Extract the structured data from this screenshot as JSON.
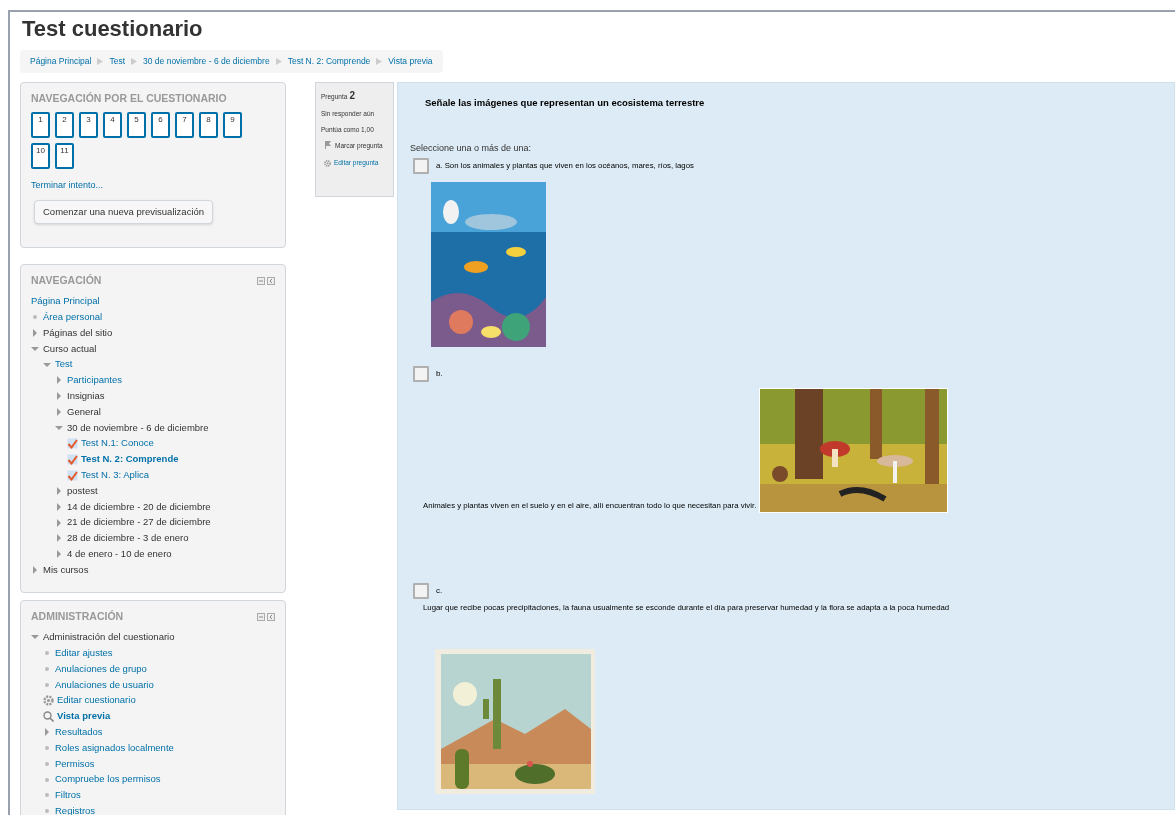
{
  "page_title": "Test cuestionario",
  "breadcrumb": [
    "Página Principal",
    "Test",
    "30 de noviembre - 6 de diciembre",
    "Test N. 2: Comprende",
    "Vista previa"
  ],
  "quiz_navigation": {
    "title": "NAVEGACIÓN POR EL CUESTIONARIO",
    "questions": [
      "1",
      "2",
      "3",
      "4",
      "5",
      "6",
      "7",
      "8",
      "9",
      "10",
      "11"
    ],
    "finish_link": "Terminar intento...",
    "button": "Comenzar una nueva previsualización"
  },
  "navigation": {
    "title": "NAVEGACIÓN",
    "items": [
      {
        "label": "Página Principal",
        "kind": "page",
        "link": true,
        "current": false
      },
      {
        "label": "Área personal",
        "kind": "bullet",
        "link": true,
        "current": false
      },
      {
        "label": "Páginas del sitio",
        "kind": "branch",
        "expanded": false,
        "link": false,
        "current": false
      },
      {
        "label": "Curso actual",
        "kind": "branch",
        "expanded": true,
        "link": false,
        "current": false,
        "children": [
          {
            "label": "Test",
            "kind": "branch",
            "expanded": true,
            "link": true,
            "current": false,
            "children": [
              {
                "label": "Participantes",
                "kind": "branch",
                "expanded": false,
                "link": true,
                "current": false
              },
              {
                "label": "Insignias",
                "kind": "branch",
                "expanded": false,
                "link": false,
                "current": false
              },
              {
                "label": "General",
                "kind": "branch",
                "expanded": false,
                "link": false,
                "current": false
              },
              {
                "label": "30 de noviembre - 6 de diciembre",
                "kind": "branch",
                "expanded": true,
                "link": false,
                "current": false,
                "children": [
                  {
                    "label": "Test N.1: Conoce",
                    "kind": "check",
                    "link": true,
                    "current": false
                  },
                  {
                    "label": "Test N. 2: Comprende",
                    "kind": "check",
                    "link": true,
                    "current": true
                  },
                  {
                    "label": "Test N. 3: Aplica",
                    "kind": "check",
                    "link": true,
                    "current": false
                  }
                ]
              },
              {
                "label": "postest",
                "kind": "branch",
                "expanded": false,
                "link": false,
                "current": false
              },
              {
                "label": "14 de diciembre - 20 de diciembre",
                "kind": "branch",
                "expanded": false,
                "link": false,
                "current": false
              },
              {
                "label": "21 de diciembre - 27 de diciembre",
                "kind": "branch",
                "expanded": false,
                "link": false,
                "current": false
              },
              {
                "label": "28 de diciembre - 3 de enero",
                "kind": "branch",
                "expanded": false,
                "link": false,
                "current": false
              },
              {
                "label": "4 de enero - 10 de enero",
                "kind": "branch",
                "expanded": false,
                "link": false,
                "current": false
              }
            ]
          }
        ]
      },
      {
        "label": "Mis cursos",
        "kind": "branch",
        "expanded": false,
        "link": false,
        "current": false
      }
    ]
  },
  "administration": {
    "title": "ADMINISTRACIÓN",
    "items": [
      {
        "label": "Administración del cuestionario",
        "kind": "branch",
        "expanded": true,
        "link": false,
        "current": false,
        "children": [
          {
            "label": "Editar ajustes",
            "kind": "bullet",
            "link": true,
            "current": false
          },
          {
            "label": "Anulaciones de grupo",
            "kind": "bullet",
            "link": true,
            "current": false
          },
          {
            "label": "Anulaciones de usuario",
            "kind": "bullet",
            "link": true,
            "current": false
          },
          {
            "label": "Editar cuestionario",
            "kind": "gear",
            "link": true,
            "current": false
          },
          {
            "label": "Vista previa",
            "kind": "search",
            "link": true,
            "current": true
          },
          {
            "label": "Resultados",
            "kind": "branch",
            "expanded": false,
            "link": true,
            "current": false
          },
          {
            "label": "Roles asignados localmente",
            "kind": "bullet",
            "link": true,
            "current": false
          },
          {
            "label": "Permisos",
            "kind": "bullet",
            "link": true,
            "current": false
          },
          {
            "label": "Compruebe los permisos",
            "kind": "bullet",
            "link": true,
            "current": false
          },
          {
            "label": "Filtros",
            "kind": "bullet",
            "link": true,
            "current": false
          },
          {
            "label": "Registros",
            "kind": "bullet",
            "link": true,
            "current": false
          }
        ]
      }
    ]
  },
  "question_info": {
    "label": "Pregunta",
    "number": "2",
    "status": "Sin responder aún",
    "grade": "Puntúa como 1,00",
    "flag": "Marcar pregunta",
    "edit": "Editar pregunta"
  },
  "question": {
    "text": "Señale las imágenes que representan un ecosistema terrestre",
    "prompt": "Seleccione una o más de una:",
    "options": [
      {
        "kind": "stacked",
        "checked": false,
        "label": "a. Son los animales y plantas que viven en los océanos, mares, ríos, lagos"
      },
      {
        "kind": "inline",
        "checked": false,
        "label": "b.",
        "text": "Animales y plantas viven en el suelo y en el aire, allí encuentran todo lo que necesitan para vivir."
      },
      {
        "kind": "stacked",
        "checked": false,
        "label": "c.",
        "text": "Lugar que recibe pocas precipitaciones, la fauna usualmente se esconde durante el día para preservar humedad y la flora se adapta a la poca humedad"
      }
    ]
  }
}
